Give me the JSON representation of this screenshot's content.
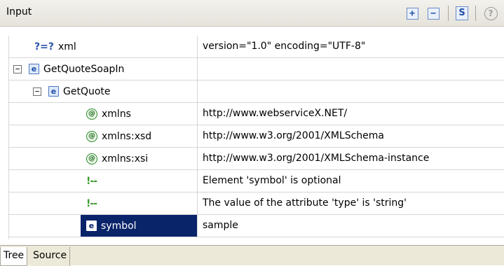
{
  "panel": {
    "title": "Input",
    "toolbar": {
      "expand_all": "+",
      "collapse_all": "−",
      "schema": "S",
      "help": "?"
    }
  },
  "tree": {
    "rows": [
      {
        "icon": "processing-instruction",
        "icon_text": "?=?",
        "label": "xml",
        "value": "version=\"1.0\" encoding=\"UTF-8\"",
        "toggle": ""
      },
      {
        "icon": "element",
        "icon_text": "e",
        "label": "GetQuoteSoapIn",
        "value": "",
        "toggle": "−"
      },
      {
        "icon": "element",
        "icon_text": "e",
        "label": "GetQuote",
        "value": "",
        "toggle": "−"
      },
      {
        "icon": "attribute",
        "icon_text": "@",
        "label": "xmlns",
        "value": "http://www.webserviceX.NET/",
        "toggle": ""
      },
      {
        "icon": "attribute",
        "icon_text": "@",
        "label": "xmlns:xsd",
        "value": "http://www.w3.org/2001/XMLSchema",
        "toggle": ""
      },
      {
        "icon": "attribute",
        "icon_text": "@",
        "label": "xmlns:xsi",
        "value": "http://www.w3.org/2001/XMLSchema-instance",
        "toggle": ""
      },
      {
        "icon": "comment",
        "icon_text": "!--",
        "label": "",
        "value": "Element 'symbol' is optional",
        "toggle": ""
      },
      {
        "icon": "comment",
        "icon_text": "!--",
        "label": "",
        "value": "The value of the attribute 'type' is 'string'",
        "toggle": ""
      },
      {
        "icon": "element",
        "icon_text": "e",
        "label": "symbol",
        "value": "sample",
        "toggle": "",
        "selected": true
      }
    ]
  },
  "tabs": [
    {
      "label": "Tree",
      "active": true
    },
    {
      "label": "Source",
      "active": false
    }
  ],
  "colors": {
    "selection": "#0a246a",
    "element_icon": "#1f4fa6",
    "attribute_icon": "#2f8a2f",
    "comment_icon": "#3b9c2e"
  }
}
